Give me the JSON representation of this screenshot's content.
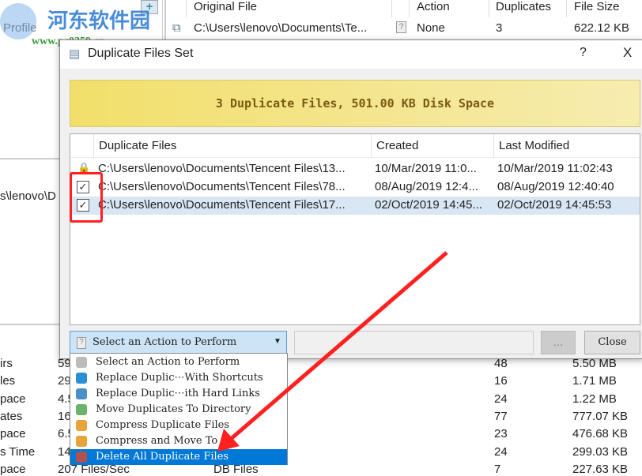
{
  "watermark": {
    "brand": "河东软件园",
    "url": "www.pc0359.cn"
  },
  "background": {
    "left_panel_text": "Profile",
    "left_path_fragment": "s\\lenovo\\D",
    "table_headers": [
      "Original File",
      "Action",
      "Duplicates",
      "File Size"
    ],
    "top_row": {
      "file": "C:\\Users\\lenovo\\Documents\\Te...",
      "action": "None",
      "duplicates": "3",
      "size": "622.12 KB"
    },
    "stat_rows": [
      {
        "label": "irs",
        "value": "59",
        "duplicates": "48",
        "size": "5.50 MB"
      },
      {
        "label": "les",
        "value": "29",
        "duplicates": "16",
        "size": "1.71 MB"
      },
      {
        "label": "pace",
        "value": "4.5",
        "duplicates": "24",
        "size": "1.22 MB"
      },
      {
        "label": "ates",
        "value": "16",
        "duplicates": "77",
        "size": "777.07 KB"
      },
      {
        "label": "pace",
        "value": "6.5",
        "duplicates": "23",
        "size": "476.68 KB"
      },
      {
        "label": "s Time",
        "value": "14",
        "duplicates": "24",
        "size": "299.03 KB"
      },
      {
        "label": "pace",
        "value": "207 Files/Sec",
        "type": "DB Files",
        "duplicates": "7",
        "size": "227.63 KB"
      }
    ]
  },
  "dialog": {
    "title": "Duplicate Files Set",
    "help": "?",
    "close_x": "X",
    "banner": "3 Duplicate Files, 501.00 KB Disk Space",
    "columns": [
      "Duplicate Files",
      "Created",
      "Last Modified"
    ],
    "rows": [
      {
        "state": "locked",
        "path": "C:\\Users\\lenovo\\Documents\\Tencent Files\\13...",
        "created": "10/Mar/2019 11:0...",
        "modified": "10/Mar/2019 11:02:43"
      },
      {
        "state": "checked",
        "path": "C:\\Users\\lenovo\\Documents\\Tencent Files\\78...",
        "created": "08/Aug/2019 12:4...",
        "modified": "08/Aug/2019 12:40:40"
      },
      {
        "state": "checked",
        "selected": true,
        "path": "C:\\Users\\lenovo\\Documents\\Tencent Files\\17...",
        "created": "02/Oct/2019 14:45...",
        "modified": "02/Oct/2019 14:45:53"
      }
    ],
    "action_select": "Select an Action to Perform",
    "path_value": "",
    "browse": "...",
    "close": "Close",
    "options": [
      {
        "label": "Select an Action to Perform",
        "icon": "question-icon",
        "color": "#bbbbbb"
      },
      {
        "label": "Replace Duplic⋯With Shortcuts",
        "icon": "arrow-right-icon",
        "color": "#2b8fd6"
      },
      {
        "label": "Replace Duplic⋯ith Hard Links",
        "icon": "hard-link-icon",
        "color": "#4a90c8"
      },
      {
        "label": "Move Duplicates To Directory",
        "icon": "move-icon",
        "color": "#6bb36b"
      },
      {
        "label": "Compress Duplicate Files",
        "icon": "compress-icon",
        "color": "#e8a33a"
      },
      {
        "label": "Compress and Move To",
        "icon": "compress-move-icon",
        "color": "#e8a33a"
      },
      {
        "label": "Delete All Duplicate Files",
        "icon": "delete-icon",
        "color": "#b05050",
        "selected": true
      }
    ]
  },
  "annotation_color": "#ff2020"
}
